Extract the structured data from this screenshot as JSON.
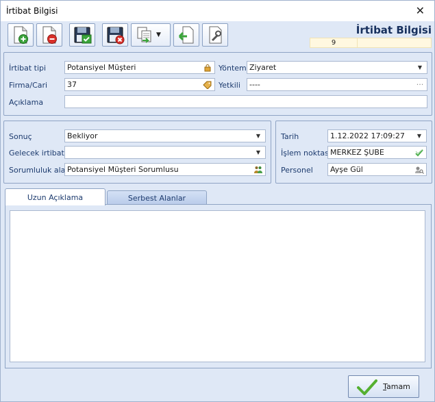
{
  "window": {
    "title": "İrtibat Bilgisi"
  },
  "toolbar": {
    "buttons": [
      {
        "name": "new-record-button",
        "icon": "document-add-icon"
      },
      {
        "name": "delete-record-button",
        "icon": "document-remove-icon"
      },
      {
        "name": "save-button",
        "icon": "floppy-check-icon"
      },
      {
        "name": "save-cancel-button",
        "icon": "floppy-cancel-icon"
      },
      {
        "name": "copy-dropdown-button",
        "icon": "copy-icon"
      },
      {
        "name": "back-button",
        "icon": "arrow-left-icon"
      },
      {
        "name": "tools-button",
        "icon": "wrench-icon"
      }
    ]
  },
  "header": {
    "brand": "İrtibat Bilgisi",
    "record_no": "9"
  },
  "general": {
    "irtibat_tipi": {
      "label": "İrtibat tipi",
      "value": "Potansiyel Müşteri"
    },
    "yontem": {
      "label": "Yöntem",
      "value": "Ziyaret"
    },
    "firma": {
      "label": "Firma/Cari",
      "value": "37"
    },
    "yetkili": {
      "label": "Yetkili",
      "value": "----"
    },
    "aciklama": {
      "label": "Açıklama",
      "value": ""
    }
  },
  "result": {
    "sonuc": {
      "label": "Sonuç",
      "value": "Bekliyor"
    },
    "gelecek": {
      "label": "Gelecek irtibat",
      "value": ""
    },
    "sorumluluk": {
      "label": "Sorumluluk alanı",
      "value": "Potansiyel Müşteri Sorumlusu"
    }
  },
  "meta": {
    "tarih": {
      "label": "Tarih",
      "value": "1.12.2022 17:09:27"
    },
    "islem": {
      "label": "İşlem noktası",
      "value": "MERKEZ ŞUBE"
    },
    "personel": {
      "label": "Personel",
      "value": "Ayşe Gül"
    }
  },
  "tabs": [
    {
      "label": "Uzun Açıklama",
      "active": true
    },
    {
      "label": "Serbest Alanlar",
      "active": false
    }
  ],
  "ok_button": {
    "label_underlined": "T",
    "label_rest": "amam"
  }
}
